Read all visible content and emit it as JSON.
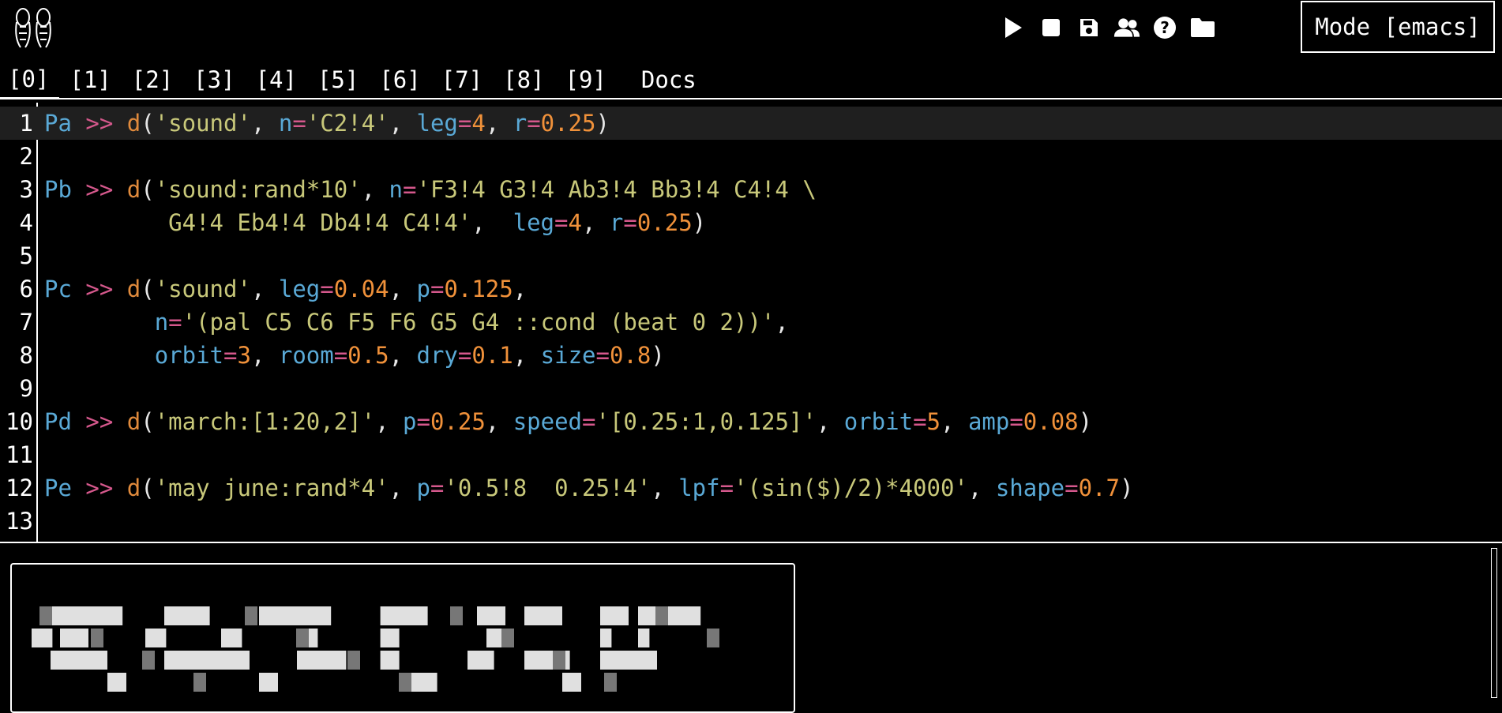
{
  "toolbar": {
    "play_icon": "play-icon",
    "stop_icon": "stop-icon",
    "save_icon": "save-icon",
    "users_icon": "users-icon",
    "help_icon": "help-icon",
    "folder_icon": "folder-icon",
    "mode_label": "Mode [emacs]"
  },
  "tabs": [
    "[0]",
    "[1]",
    "[2]",
    "[3]",
    "[4]",
    "[5]",
    "[6]",
    "[7]",
    "[8]",
    "[9]",
    "Docs"
  ],
  "active_tab": 0,
  "line_numbers": [
    "1",
    "2",
    "3",
    "4",
    "5",
    "6",
    "7",
    "8",
    "9",
    "10",
    "11",
    "12",
    "13"
  ],
  "current_line": 1,
  "code_lines": [
    [
      [
        "n",
        "Pa"
      ],
      [
        "p",
        " "
      ],
      [
        "o",
        ">>"
      ],
      [
        "p",
        " "
      ],
      [
        "f",
        "d"
      ],
      [
        "p",
        "("
      ],
      [
        "s",
        "'sound'"
      ],
      [
        "p",
        ", "
      ],
      [
        "n",
        "n"
      ],
      [
        "o",
        "="
      ],
      [
        "s",
        "'C2!4'"
      ],
      [
        "p",
        ", "
      ],
      [
        "n",
        "leg"
      ],
      [
        "o",
        "="
      ],
      [
        "num",
        "4"
      ],
      [
        "p",
        ", "
      ],
      [
        "n",
        "r"
      ],
      [
        "o",
        "="
      ],
      [
        "num",
        "0.25"
      ],
      [
        "p",
        ")"
      ]
    ],
    [],
    [
      [
        "n",
        "Pb"
      ],
      [
        "p",
        " "
      ],
      [
        "o",
        ">>"
      ],
      [
        "p",
        " "
      ],
      [
        "f",
        "d"
      ],
      [
        "p",
        "("
      ],
      [
        "s",
        "'sound:rand*10'"
      ],
      [
        "p",
        ", "
      ],
      [
        "n",
        "n"
      ],
      [
        "o",
        "="
      ],
      [
        "s",
        "'F3!4 G3!4 Ab3!4 Bb3!4 C4!4 \\"
      ]
    ],
    [
      [
        "s",
        "         G4!4 Eb4!4 Db4!4 C4!4'"
      ],
      [
        "p",
        ",  "
      ],
      [
        "n",
        "leg"
      ],
      [
        "o",
        "="
      ],
      [
        "num",
        "4"
      ],
      [
        "p",
        ", "
      ],
      [
        "n",
        "r"
      ],
      [
        "o",
        "="
      ],
      [
        "num",
        "0.25"
      ],
      [
        "p",
        ")"
      ]
    ],
    [],
    [
      [
        "n",
        "Pc"
      ],
      [
        "p",
        " "
      ],
      [
        "o",
        ">>"
      ],
      [
        "p",
        " "
      ],
      [
        "f",
        "d"
      ],
      [
        "p",
        "("
      ],
      [
        "s",
        "'sound'"
      ],
      [
        "p",
        ", "
      ],
      [
        "n",
        "leg"
      ],
      [
        "o",
        "="
      ],
      [
        "num",
        "0.04"
      ],
      [
        "p",
        ", "
      ],
      [
        "n",
        "p"
      ],
      [
        "o",
        "="
      ],
      [
        "num",
        "0.125"
      ],
      [
        "p",
        ","
      ]
    ],
    [
      [
        "p",
        "        "
      ],
      [
        "n",
        "n"
      ],
      [
        "o",
        "="
      ],
      [
        "s",
        "'(pal C5 C6 F5 F6 G5 G4 ::cond (beat 0 2))'"
      ],
      [
        "p",
        ","
      ]
    ],
    [
      [
        "p",
        "        "
      ],
      [
        "n",
        "orbit"
      ],
      [
        "o",
        "="
      ],
      [
        "num",
        "3"
      ],
      [
        "p",
        ", "
      ],
      [
        "n",
        "room"
      ],
      [
        "o",
        "="
      ],
      [
        "num",
        "0.5"
      ],
      [
        "p",
        ", "
      ],
      [
        "n",
        "dry"
      ],
      [
        "o",
        "="
      ],
      [
        "num",
        "0.1"
      ],
      [
        "p",
        ", "
      ],
      [
        "n",
        "size"
      ],
      [
        "o",
        "="
      ],
      [
        "num",
        "0.8"
      ],
      [
        "p",
        ")"
      ]
    ],
    [],
    [
      [
        "n",
        "Pd"
      ],
      [
        "p",
        " "
      ],
      [
        "o",
        ">>"
      ],
      [
        "p",
        " "
      ],
      [
        "f",
        "d"
      ],
      [
        "p",
        "("
      ],
      [
        "s",
        "'march:[1:20,2]'"
      ],
      [
        "p",
        ", "
      ],
      [
        "n",
        "p"
      ],
      [
        "o",
        "="
      ],
      [
        "num",
        "0.25"
      ],
      [
        "p",
        ", "
      ],
      [
        "n",
        "speed"
      ],
      [
        "o",
        "="
      ],
      [
        "s",
        "'[0.25:1,0.125]'"
      ],
      [
        "p",
        ", "
      ],
      [
        "n",
        "orbit"
      ],
      [
        "o",
        "="
      ],
      [
        "num",
        "5"
      ],
      [
        "p",
        ", "
      ],
      [
        "n",
        "amp"
      ],
      [
        "o",
        "="
      ],
      [
        "num",
        "0.08"
      ],
      [
        "p",
        ")"
      ]
    ],
    [],
    [
      [
        "n",
        "Pe"
      ],
      [
        "p",
        " "
      ],
      [
        "o",
        ">>"
      ],
      [
        "p",
        " "
      ],
      [
        "f",
        "d"
      ],
      [
        "p",
        "("
      ],
      [
        "s",
        "'may june:rand*4'"
      ],
      [
        "p",
        ", "
      ],
      [
        "n",
        "p"
      ],
      [
        "o",
        "="
      ],
      [
        "s",
        "'0.5!8  0.25!4'"
      ],
      [
        "p",
        ", "
      ],
      [
        "n",
        "lpf"
      ],
      [
        "o",
        "="
      ],
      [
        "s",
        "'(sin($)/2)*4000'"
      ],
      [
        "p",
        ", "
      ],
      [
        "n",
        "shape"
      ],
      [
        "o",
        "="
      ],
      [
        "num",
        "0.7"
      ],
      [
        "p",
        ")"
      ]
    ],
    []
  ]
}
